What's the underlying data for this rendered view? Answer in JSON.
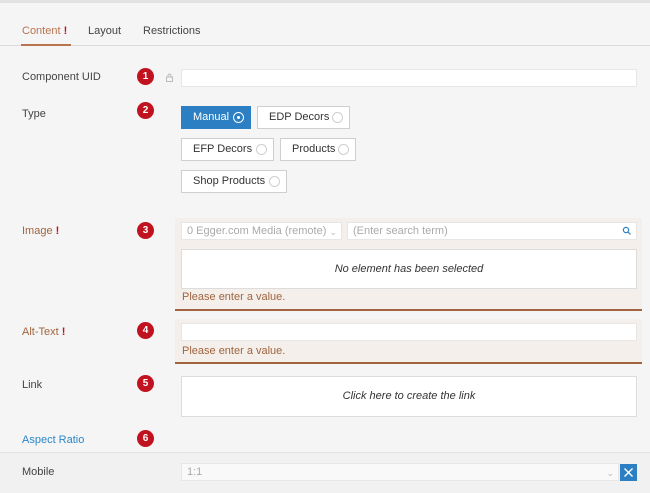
{
  "tabs": [
    {
      "label": "Content",
      "marker": "!"
    },
    {
      "label": "Layout"
    },
    {
      "label": "Restrictions"
    }
  ],
  "fields": {
    "uid": {
      "label": "Component UID",
      "badge": "1",
      "value": ""
    },
    "type": {
      "label": "Type",
      "badge": "2",
      "options": [
        "Manual",
        "EDP Decors",
        "EFP Decors",
        "Products",
        "Shop Products"
      ],
      "selected": "Manual"
    },
    "image": {
      "label": "Image",
      "required": "!",
      "badge": "3",
      "source": "0 Egger.com Media (remote)",
      "search_placeholder": "(Enter search term)",
      "empty_text": "No element has been selected",
      "error": "Please enter a value."
    },
    "alt": {
      "label": "Alt-Text",
      "required": "!",
      "badge": "4",
      "value": "",
      "error": "Please enter a value."
    },
    "link": {
      "label": "Link",
      "badge": "5",
      "placeholder": "Click here to create the link"
    },
    "aspect": {
      "label": "Aspect Ratio",
      "badge": "6"
    }
  },
  "footer": {
    "label": "Mobile",
    "value": "1:1"
  },
  "colors": {
    "accent": "#2b7fc2",
    "required": "#a0643e",
    "badge": "#c1121f"
  }
}
